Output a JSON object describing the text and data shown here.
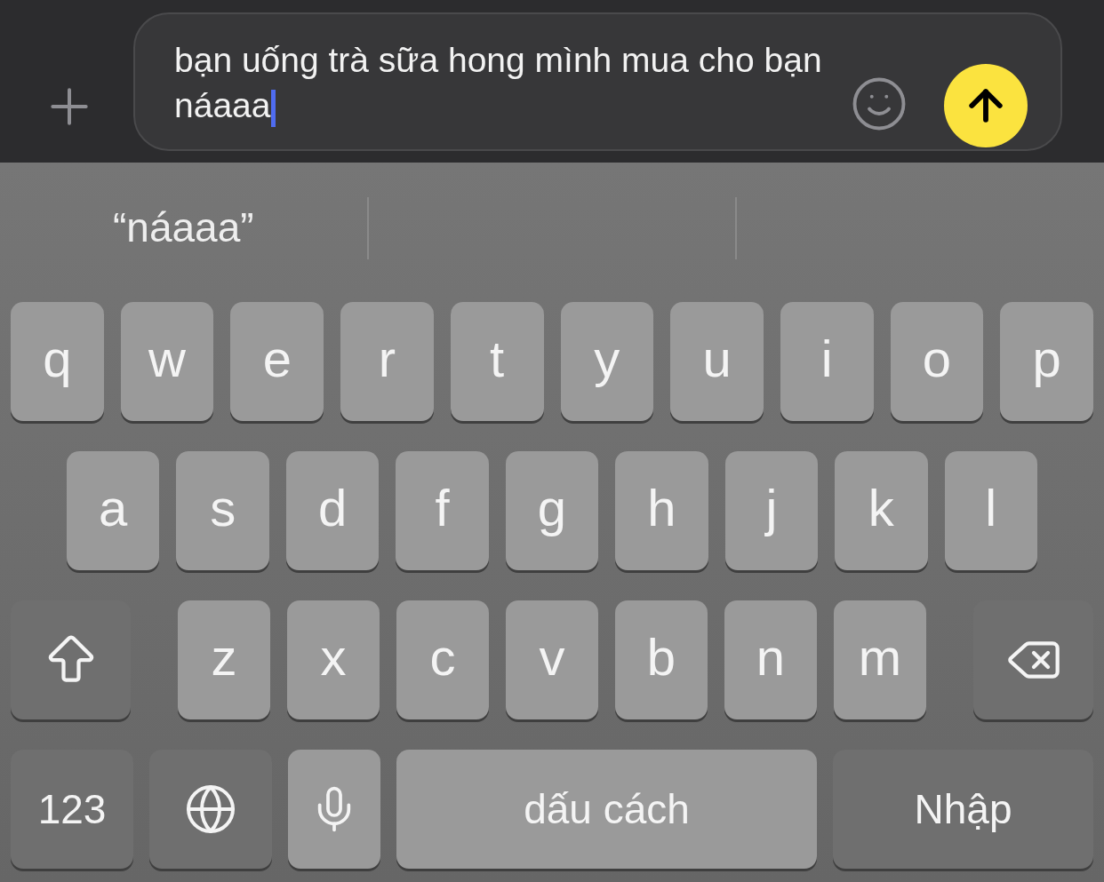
{
  "composer": {
    "message": "bạn uống trà sữa hong mình mua cho bạn náaaa"
  },
  "suggestions": [
    "“náaaa”"
  ],
  "keyboard": {
    "letter_rows": [
      {
        "keys": [
          {
            "kind": "letter",
            "label": "q"
          },
          {
            "kind": "letter",
            "label": "w"
          },
          {
            "kind": "letter",
            "label": "e"
          },
          {
            "kind": "letter",
            "label": "r"
          },
          {
            "kind": "letter",
            "label": "t"
          },
          {
            "kind": "letter",
            "label": "y"
          },
          {
            "kind": "letter",
            "label": "u"
          },
          {
            "kind": "letter",
            "label": "i"
          },
          {
            "kind": "letter",
            "label": "o"
          },
          {
            "kind": "letter",
            "label": "p"
          }
        ]
      },
      {
        "keys": [
          {
            "kind": "letter",
            "label": "a"
          },
          {
            "kind": "letter",
            "label": "s"
          },
          {
            "kind": "letter",
            "label": "d"
          },
          {
            "kind": "letter",
            "label": "f"
          },
          {
            "kind": "letter",
            "label": "g"
          },
          {
            "kind": "letter",
            "label": "h"
          },
          {
            "kind": "letter",
            "label": "j"
          },
          {
            "kind": "letter",
            "label": "k"
          },
          {
            "kind": "letter",
            "label": "l"
          }
        ]
      },
      {
        "keys": [
          {
            "kind": "shift"
          },
          {
            "kind": "letter",
            "label": "z"
          },
          {
            "kind": "letter",
            "label": "x"
          },
          {
            "kind": "letter",
            "label": "c"
          },
          {
            "kind": "letter",
            "label": "v"
          },
          {
            "kind": "letter",
            "label": "b"
          },
          {
            "kind": "letter",
            "label": "n"
          },
          {
            "kind": "letter",
            "label": "m"
          },
          {
            "kind": "delete"
          }
        ]
      }
    ],
    "bottom_row": {
      "keys": [
        {
          "kind": "numbers",
          "label": "123"
        },
        {
          "kind": "globe"
        },
        {
          "kind": "mic"
        },
        {
          "kind": "space",
          "label": "dấu cách"
        },
        {
          "kind": "return",
          "label": "Nhập"
        }
      ]
    }
  }
}
